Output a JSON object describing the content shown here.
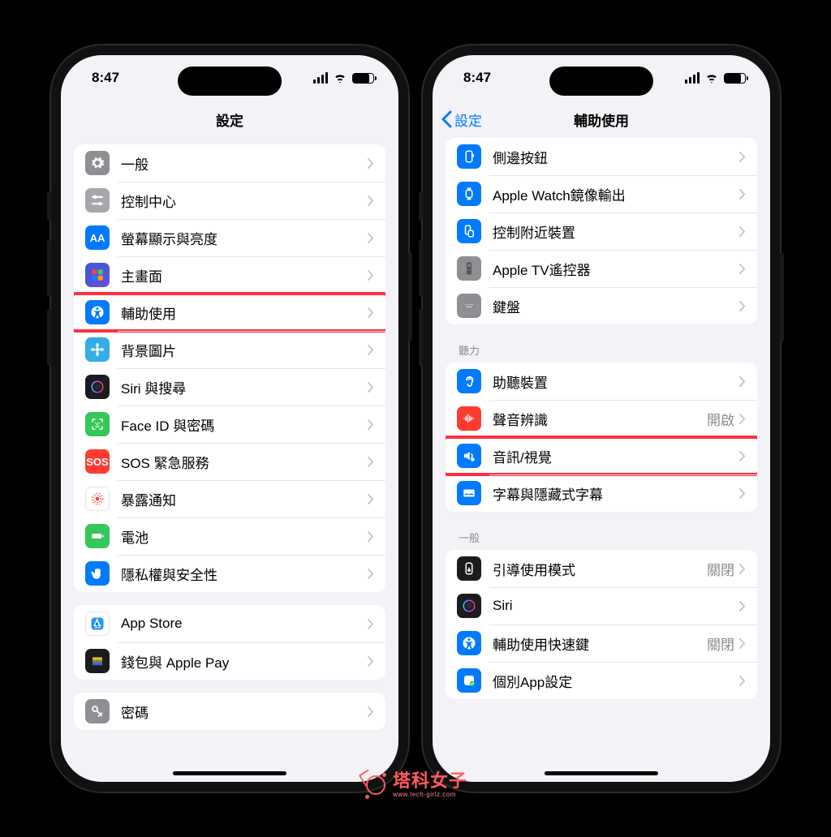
{
  "status": {
    "time": "8:47"
  },
  "left": {
    "title": "設定",
    "groups": [
      {
        "rows": [
          {
            "id": "general",
            "label": "一般",
            "icon": "gear-icon",
            "bg": "bg-gray"
          },
          {
            "id": "control-center",
            "label": "控制中心",
            "icon": "sliders-icon",
            "bg": "bg-gray-l"
          },
          {
            "id": "display",
            "label": "螢幕顯示與亮度",
            "icon": "text-size-icon",
            "bg": "bg-blue",
            "text": "AA"
          },
          {
            "id": "home-screen",
            "label": "主畫面",
            "icon": "grid-icon",
            "bg": "bg-indigo"
          },
          {
            "id": "accessibility",
            "label": "輔助使用",
            "icon": "accessibility-icon",
            "bg": "bg-blue",
            "highlight": true
          },
          {
            "id": "wallpaper",
            "label": "背景圖片",
            "icon": "flower-icon",
            "bg": "bg-cyan"
          },
          {
            "id": "siri",
            "label": "Siri 與搜尋",
            "icon": "siri-icon",
            "bg": "bg-black"
          },
          {
            "id": "faceid",
            "label": "Face ID 與密碼",
            "icon": "faceid-icon",
            "bg": "bg-green"
          },
          {
            "id": "sos",
            "label": "SOS 緊急服務",
            "icon": "sos-icon",
            "bg": "bg-red",
            "text": "SOS"
          },
          {
            "id": "exposure",
            "label": "暴露通知",
            "icon": "exposure-icon",
            "bg": "bg-white-b"
          },
          {
            "id": "battery",
            "label": "電池",
            "icon": "battery-icon",
            "bg": "bg-green"
          },
          {
            "id": "privacy",
            "label": "隱私權與安全性",
            "icon": "hand-icon",
            "bg": "bg-blue"
          }
        ]
      },
      {
        "rows": [
          {
            "id": "appstore",
            "label": "App Store",
            "icon": "appstore-icon",
            "bg": "bg-white-b"
          },
          {
            "id": "wallet",
            "label": "錢包與 Apple Pay",
            "icon": "wallet-icon",
            "bg": "bg-black"
          }
        ]
      },
      {
        "rows": [
          {
            "id": "passwords",
            "label": "密碼",
            "icon": "key-icon",
            "bg": "bg-gray"
          }
        ]
      }
    ]
  },
  "right": {
    "back": "設定",
    "title": "輔助使用",
    "group_top": [
      {
        "id": "side-button",
        "label": "側邊按鈕",
        "icon": "side-button-icon",
        "bg": "bg-blue"
      },
      {
        "id": "watch-mirror",
        "label": "Apple Watch鏡像輸出",
        "icon": "watch-icon",
        "bg": "bg-blue"
      },
      {
        "id": "nearby",
        "label": "控制附近裝置",
        "icon": "nearby-icon",
        "bg": "bg-blue"
      },
      {
        "id": "appletv",
        "label": "Apple TV遙控器",
        "icon": "remote-icon",
        "bg": "bg-gray"
      },
      {
        "id": "keyboards",
        "label": "鍵盤",
        "icon": "keyboard-icon",
        "bg": "bg-gray"
      }
    ],
    "sections": [
      {
        "header": "聽力",
        "rows": [
          {
            "id": "hearing-devices",
            "label": "助聽裝置",
            "icon": "ear-icon",
            "bg": "bg-blue"
          },
          {
            "id": "sound-recognition",
            "label": "聲音辨識",
            "icon": "waveform-icon",
            "bg": "bg-red",
            "detail": "開啟"
          },
          {
            "id": "audio-visual",
            "label": "音訊/視覺",
            "icon": "audiovisual-icon",
            "bg": "bg-blue",
            "highlight": true
          },
          {
            "id": "subtitles",
            "label": "字幕與隱藏式字幕",
            "icon": "subtitles-icon",
            "bg": "bg-blue"
          }
        ]
      },
      {
        "header": "一般",
        "rows": [
          {
            "id": "guided-access",
            "label": "引導使用模式",
            "icon": "guided-icon",
            "bg": "bg-black",
            "detail": "關閉"
          },
          {
            "id": "siri-a",
            "label": "Siri",
            "icon": "siri-icon",
            "bg": "bg-black"
          },
          {
            "id": "shortcut",
            "label": "輔助使用快速鍵",
            "icon": "accessibility-icon",
            "bg": "bg-blue",
            "detail": "關閉"
          },
          {
            "id": "per-app",
            "label": "個別App設定",
            "icon": "per-app-icon",
            "bg": "bg-blue"
          }
        ]
      }
    ]
  },
  "watermark": {
    "main": "塔科女子",
    "sub": "www.tech-girlz.com"
  }
}
